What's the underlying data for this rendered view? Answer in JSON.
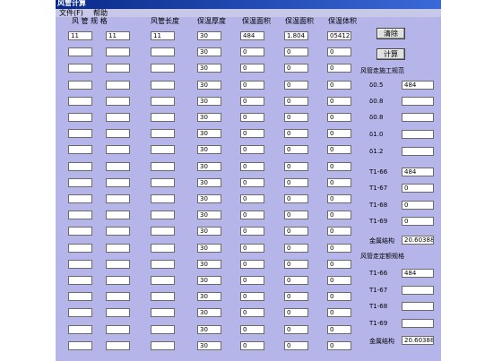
{
  "window": {
    "title": "风管计算"
  },
  "menu": {
    "file": "文件(F)",
    "help": "帮助"
  },
  "headers": [
    "风  管  规  格",
    "风管长度",
    "保温厚度",
    "保温面积",
    "保温面积",
    "保温体积"
  ],
  "first_row": [
    "11",
    "11",
    "11",
    "30",
    "484",
    "1.804",
    "05412"
  ],
  "default_row": [
    "",
    "",
    "",
    "30",
    "0",
    "0",
    "0"
  ],
  "row_count": 20,
  "buttons": {
    "clear": "清除",
    "calc": "计算"
  },
  "right_panel": {
    "section1_title": "风管走施工规范",
    "delta_rows": [
      {
        "label": "δ0.5",
        "value": "484"
      },
      {
        "label": "δ0.8",
        "value": ""
      },
      {
        "label": "δ0.8",
        "value": ""
      },
      {
        "label": "δ1.0",
        "value": ""
      },
      {
        "label": "δ1.2",
        "value": ""
      }
    ],
    "t_rows_1": [
      {
        "label": "T1-66",
        "value": "484"
      },
      {
        "label": "T1-67",
        "value": "0"
      },
      {
        "label": "T1-68",
        "value": "0"
      },
      {
        "label": "T1-69",
        "value": "0"
      }
    ],
    "metal1": {
      "label": "金属结构",
      "value": "20.60388"
    },
    "section2_title": "风管走定额规格",
    "t_rows_2": [
      {
        "label": "T1-66",
        "value": "484"
      },
      {
        "label": "T1-67",
        "value": ""
      },
      {
        "label": "T1-68",
        "value": ""
      },
      {
        "label": "T1-69",
        "value": ""
      }
    ],
    "metal2": {
      "label": "金属结构",
      "value": "20.60388"
    }
  }
}
